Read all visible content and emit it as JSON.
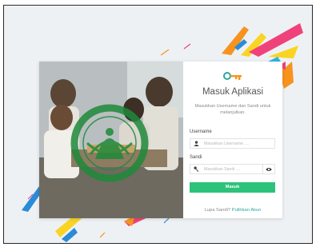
{
  "login": {
    "title": "Masuk Aplikasi",
    "subtitle": "Masukkan Username dan Sandi untuk melanjutkan.",
    "username_label": "Username",
    "username_placeholder": "Masukkan Username ....",
    "password_label": "Sandi",
    "password_placeholder": "Masukkan Sandi ....",
    "submit_label": "Masuk",
    "forgot_text": "Lupa Sandi?",
    "forgot_link": "Pulihkan Akun"
  },
  "icons": {
    "header": "key-icon",
    "username": "user-icon",
    "password": "key-icon",
    "toggle": "eye-icon"
  },
  "colors": {
    "accent": "#2dc27a",
    "link": "#2aa7a0",
    "deco_pink": "#f0427a",
    "deco_orange": "#f7931e",
    "deco_yellow": "#f9d423",
    "deco_blue": "#2a8bd8"
  }
}
